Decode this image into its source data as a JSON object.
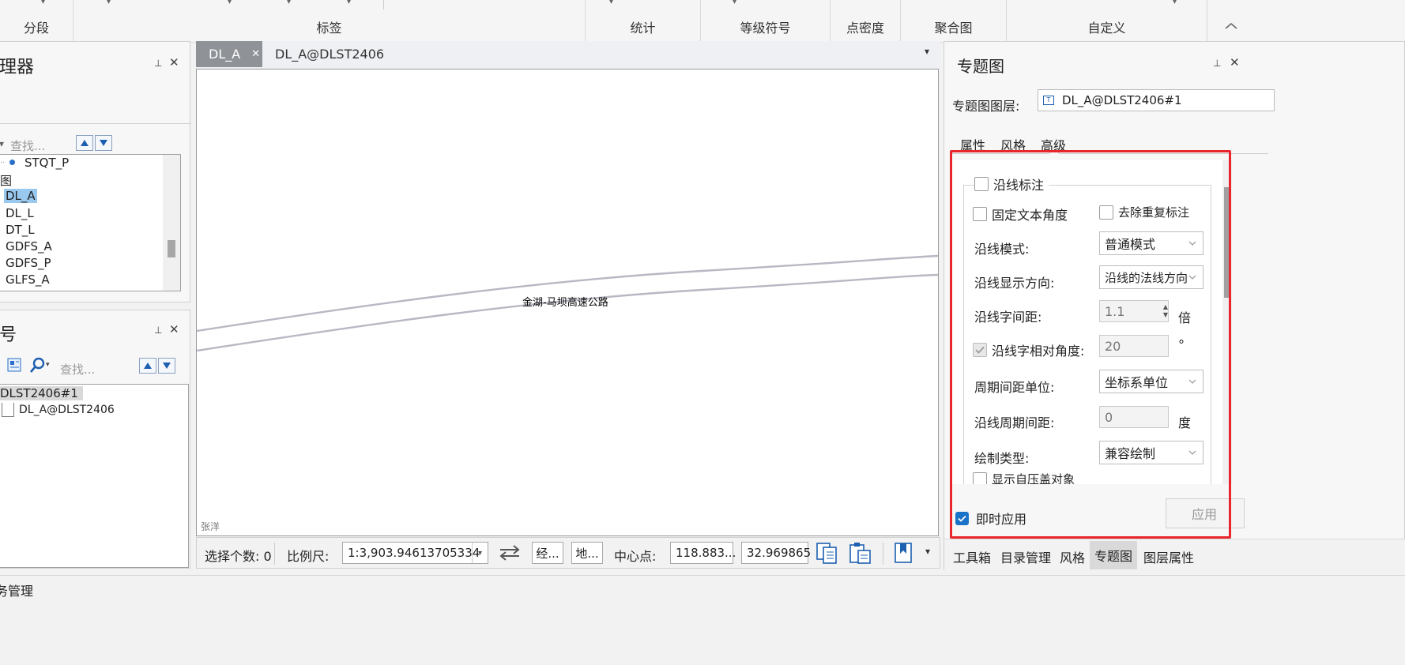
{
  "ribbon": {
    "groups": [
      "分段",
      "标签",
      "统计",
      "等级符号",
      "点密度",
      "聚合图",
      "自定义"
    ]
  },
  "left_top_panel": {
    "title": "理器",
    "search_placeholder": "查找...",
    "tree": [
      "STQT_P",
      "图",
      "DL_A",
      "DL_L",
      "DT_L",
      "GDFS_A",
      "GDFS_P",
      "GLFS_A"
    ]
  },
  "left_bottom_panel": {
    "title": "号",
    "search_placeholder": "查找...",
    "tree": [
      "DLST2406#1",
      "DL_A@DLST2406"
    ]
  },
  "bottom_strip": {
    "label": "务管理"
  },
  "doc_tabs": {
    "active": "DL_A",
    "inactive": "DL_A@DLST2406"
  },
  "map": {
    "road_label": "金湖-马坝高速公路",
    "author": "张洋"
  },
  "status_bar": {
    "select_count": "选择个数: 0",
    "scale_label": "比例尺:",
    "scale_value": "1:3,903.94613705334",
    "btn_lon": "经...",
    "btn_map": "地...",
    "center_label": "中心点:",
    "center_x": "118.883...",
    "center_y": "32.969865"
  },
  "right_panel": {
    "title": "专题图",
    "layer_label": "专题图图层:",
    "layer_value": "DL_A@DLST2406#1",
    "tabs": [
      "属性",
      "风格",
      "高级"
    ],
    "active_tab": "高级",
    "group_title": "沿线标注",
    "fixed_angle": "固定文本角度",
    "remove_dup": "去除重复标注",
    "mode_label": "沿线模式:",
    "mode_value": "普通模式",
    "direction_label": "沿线显示方向:",
    "direction_value": "沿线的法线方向",
    "spacing_label": "沿线字间距:",
    "spacing_value": "1.1",
    "spacing_unit": "倍",
    "rel_angle_label": "沿线字相对角度:",
    "rel_angle_value": "20",
    "rel_angle_unit": "°",
    "period_unit_label": "周期间距单位:",
    "period_unit_value": "坐标系单位",
    "period_label": "沿线周期间距:",
    "period_value": "0",
    "period_unit": "度",
    "draw_type_label": "绘制类型:",
    "draw_type_value": "兼容绘制",
    "show_overlap": "显示自压盖对象",
    "instant_apply": "即时应用",
    "apply_btn": "应用",
    "highlight_color": "#e8262b",
    "accent_color": "#1a73c7",
    "bottom_tabs": [
      "工具箱",
      "目录管理",
      "风格",
      "专题图",
      "图层属性"
    ],
    "active_bottom_tab": "专题图"
  }
}
